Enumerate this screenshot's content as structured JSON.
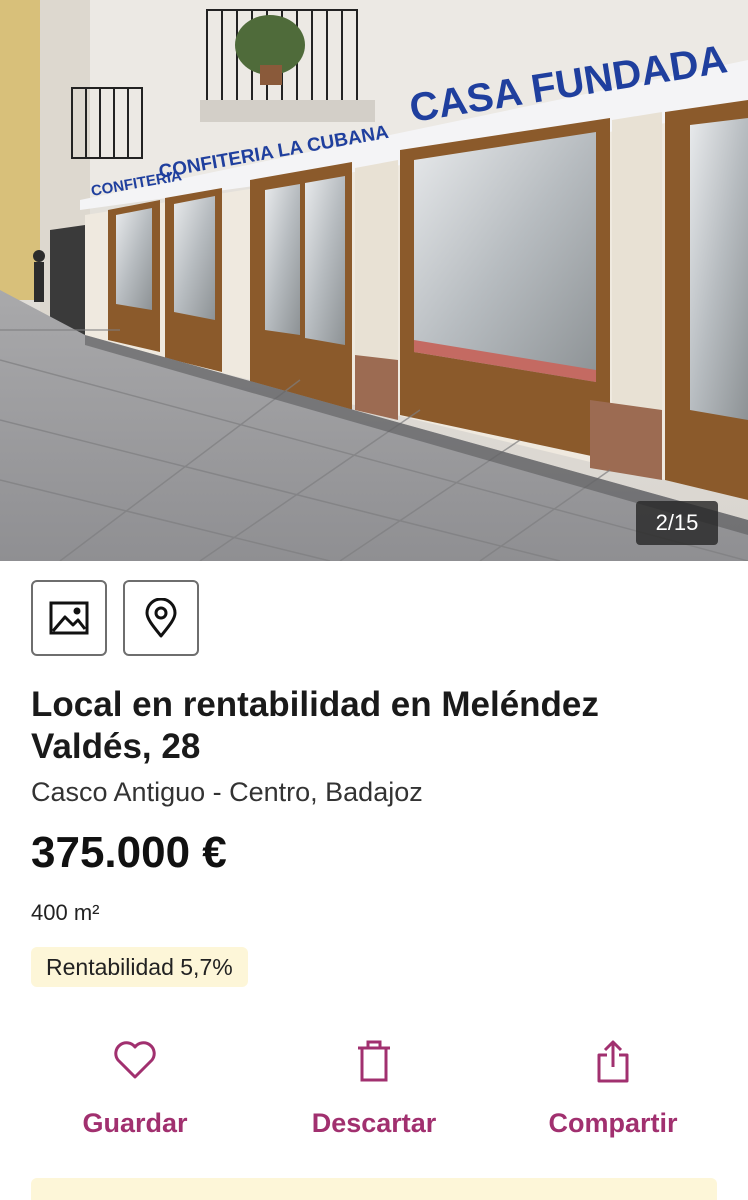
{
  "gallery": {
    "counter": "2/15",
    "sign_left": "CONFITERIA LA CUBANA",
    "sign_left_partial": "CONFITERIA",
    "sign_right": "CASA FUNDADA"
  },
  "view_toggles": [
    {
      "name": "photos",
      "icon": "image-icon"
    },
    {
      "name": "map",
      "icon": "map-pin-icon"
    }
  ],
  "listing": {
    "title": "Local en rentabilidad en Meléndez Valdés, 28",
    "location": "Casco Antiguo - Centro, Badajoz",
    "price": "375.000 €",
    "surface": "400 m²",
    "badge": "Rentabilidad 5,7%"
  },
  "actions": {
    "save": {
      "label": "Guardar",
      "icon": "heart-icon"
    },
    "discard": {
      "label": "Descartar",
      "icon": "trash-icon"
    },
    "share": {
      "label": "Compartir",
      "icon": "share-icon"
    }
  },
  "colors": {
    "accent": "#a1306f",
    "badge_bg": "#fdf6d8",
    "sign_text": "#1f3f9e"
  }
}
